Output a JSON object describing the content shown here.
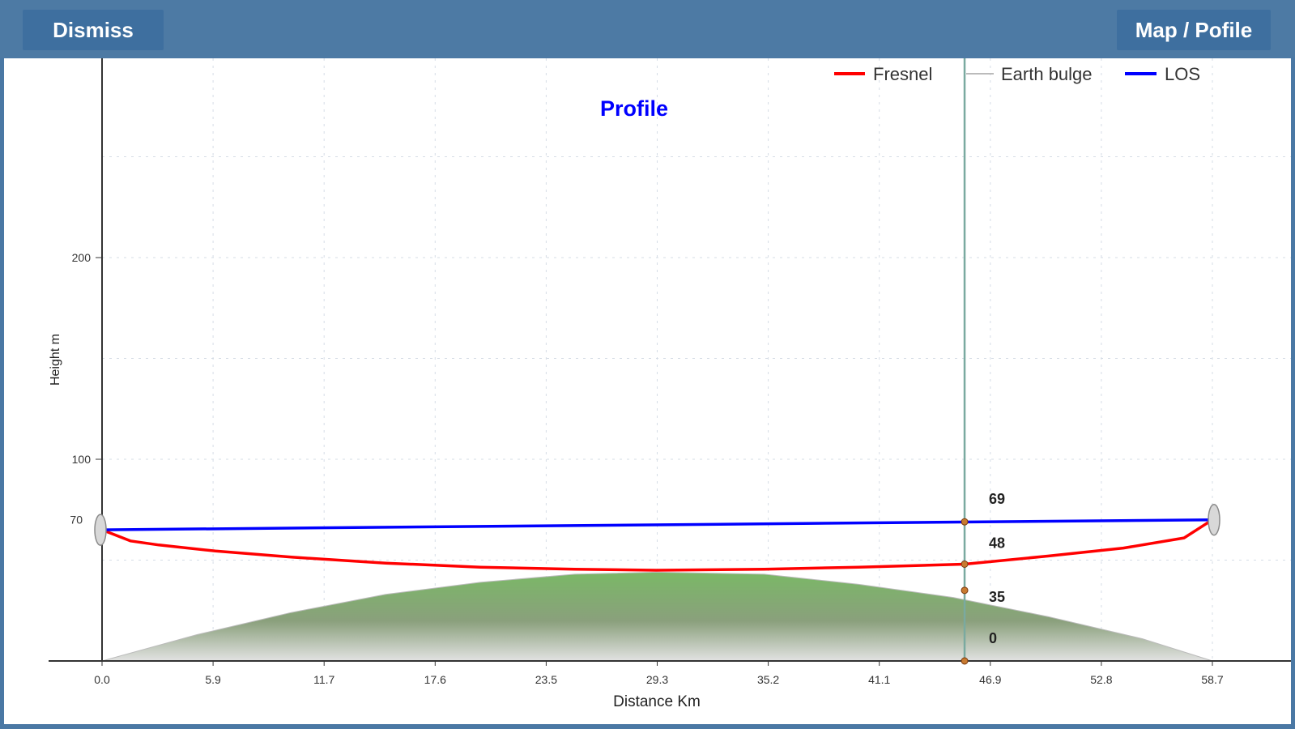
{
  "toolbar": {
    "dismiss_label": "Dismiss",
    "map_profile_label": "Map / Pofile"
  },
  "chart_data": {
    "type": "line",
    "title": "Profile",
    "xlabel": "Distance Km",
    "ylabel": "Height m",
    "x_ticks": [
      "0.0",
      "5.9",
      "11.7",
      "17.6",
      "23.5",
      "29.3",
      "35.2",
      "41.1",
      "46.9",
      "52.8",
      "58.7"
    ],
    "y_ticks": [
      "100",
      "200"
    ],
    "y_extra_tick": "70",
    "xlim": [
      0,
      58.7
    ],
    "ylim": [
      0,
      300
    ],
    "grid": true,
    "legend_position": "top-right",
    "legend": [
      "Fresnel",
      "Earth bulge",
      "LOS"
    ],
    "colors": {
      "fresnel": "#ff0000",
      "earth_bulge": "#bbbbbb",
      "los": "#0000ff",
      "title": "#0000ff",
      "terrain": "#78b060",
      "cursor": "#7aaaa0"
    },
    "series": [
      {
        "name": "LOS",
        "x": [
          0,
          58.7
        ],
        "y": [
          65,
          70
        ]
      },
      {
        "name": "Fresnel",
        "x": [
          0,
          1.5,
          3,
          6,
          10,
          15,
          20,
          25,
          29.3,
          35,
          40,
          45.6,
          50,
          54,
          57.2,
          58.7
        ],
        "y": [
          65,
          59.5,
          57.5,
          54.5,
          51.5,
          48.5,
          46.5,
          45.5,
          45,
          45.5,
          46.5,
          48,
          52,
          56,
          61,
          70
        ]
      },
      {
        "name": "Earth bulge",
        "x": [
          0,
          5,
          10,
          15,
          20,
          25,
          29.3,
          35,
          40,
          45,
          50,
          55,
          58.7
        ],
        "y": [
          0,
          13,
          24,
          33,
          39,
          43,
          44,
          43,
          38,
          31.5,
          22,
          11,
          0
        ]
      }
    ],
    "cursor": {
      "x": 45.6,
      "labels": [
        "69",
        "48",
        "35",
        "0"
      ],
      "values": [
        69,
        48,
        35,
        0
      ]
    }
  }
}
